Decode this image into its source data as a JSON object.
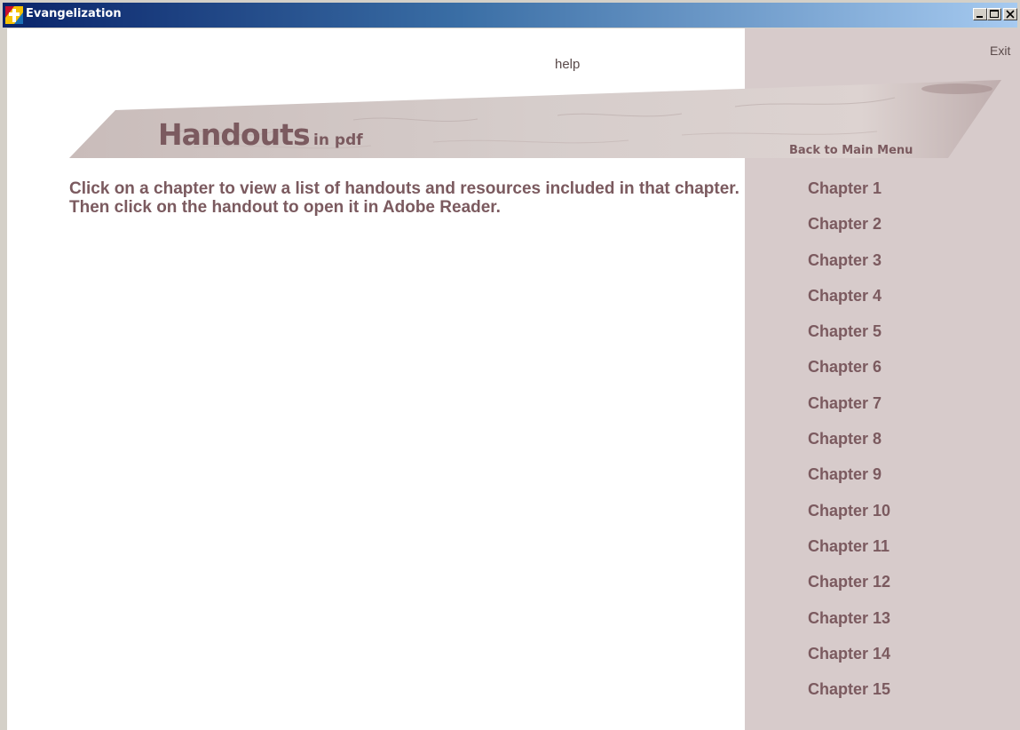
{
  "window": {
    "title": "Evangelization",
    "buttons": {
      "minimize": "minimize-icon",
      "maximize": "maximize-icon",
      "close": "close-icon"
    }
  },
  "header": {
    "help_label": "help",
    "exit_label": "Exit"
  },
  "banner": {
    "title": "Handouts",
    "subtitle": "in pdf",
    "back_label": "Back to Main Menu"
  },
  "main": {
    "instructions": "Click on a chapter to view a list of handouts and resources included in that chapter. Then click on the handout to open it in Adobe Reader."
  },
  "sidebar": {
    "chapters": [
      "Chapter 1",
      "Chapter 2",
      "Chapter 3",
      "Chapter 4",
      "Chapter 5",
      "Chapter 6",
      "Chapter 7",
      "Chapter 8",
      "Chapter 9",
      "Chapter 10",
      "Chapter 11",
      "Chapter 12",
      "Chapter 13",
      "Chapter 14",
      "Chapter 15"
    ]
  },
  "colors": {
    "accent_text": "#7b5a5f",
    "sidebar_bg": "#d7cbcb",
    "titlebar_start": "#0a246a",
    "titlebar_end": "#a6caf0"
  }
}
